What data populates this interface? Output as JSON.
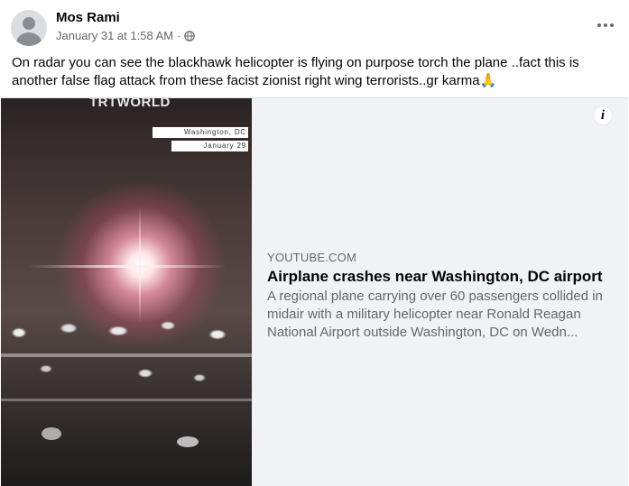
{
  "post": {
    "author": "Mos Rami",
    "timestamp": "January 31 at 1:58 AM",
    "separator": "·",
    "privacy_icon": "globe-icon",
    "more_icon": "more-horizontal-icon",
    "text": "On radar you can see the blackhawk helicopter is flying on purpose torch the plane ..fact this is another false flag attack from these facist zionist right wing terrorists..gr karma🙏"
  },
  "link_card": {
    "thumbnail": {
      "channel_logo": "TRTWORLD",
      "location_label": "Washington, DC",
      "date_label": "January 29"
    },
    "info_icon": "info-icon",
    "info_glyph": "i",
    "domain": "YOUTUBE.COM",
    "title": "Airplane crashes near Washington, DC airport",
    "description": "A regional plane carrying over 60 passengers collided in midair with a military helicopter near Ronald Reagan National Airport outside Washington, DC on Wedn..."
  },
  "colors": {
    "primary_text": "#050505",
    "secondary_text": "#65676b",
    "card_background": "#f0f2f5",
    "divider": "#dadde1"
  }
}
